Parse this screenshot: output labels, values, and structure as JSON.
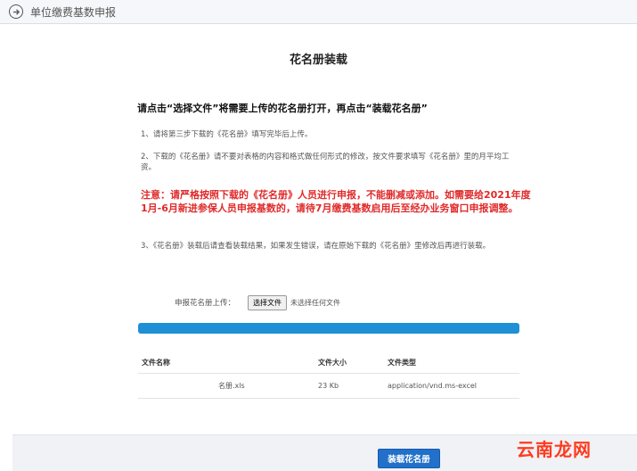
{
  "header": {
    "title": "单位缴费基数申报"
  },
  "page": {
    "title": "花名册装载",
    "instruction": "请点击“选择文件”将需要上传的花名册打开，再点击“装载花名册”",
    "steps": [
      "1、请将第三步下载的《花名册》填写完毕后上传。",
      "2、下载的《花名册》请不要对表格的内容和格式做任何形式的修改，按文件要求填写《花名册》里的月平均工资。",
      "3、《花名册》装载后请查看装载结果，如果发生错误，请在原始下载的《花名册》里修改后再进行装载。"
    ],
    "warning": "注意：请严格按照下载的《花名册》人员进行申报，不能删减或添加。如需要给2021年度1月-6月新进参保人员申报基数的，请待7月缴费基数启用后至经办业务窗口申报调整。"
  },
  "upload": {
    "label": "申报花名册上传：",
    "button": "选择文件",
    "no_file": "未选择任何文件"
  },
  "progress": {
    "value": 1.0
  },
  "file_table": {
    "headers": [
      "文件名称",
      "文件大小",
      "文件类型"
    ],
    "rows": [
      {
        "name": "名册.xls",
        "size": "23 Kb",
        "type": "application/vnd.ms-excel"
      }
    ]
  },
  "footer": {
    "load_button": "装载花名册"
  },
  "watermark": "云南龙网",
  "colors": {
    "warning": "#e02a2a",
    "progress": "#1f8fd6",
    "button": "#2170c9"
  }
}
